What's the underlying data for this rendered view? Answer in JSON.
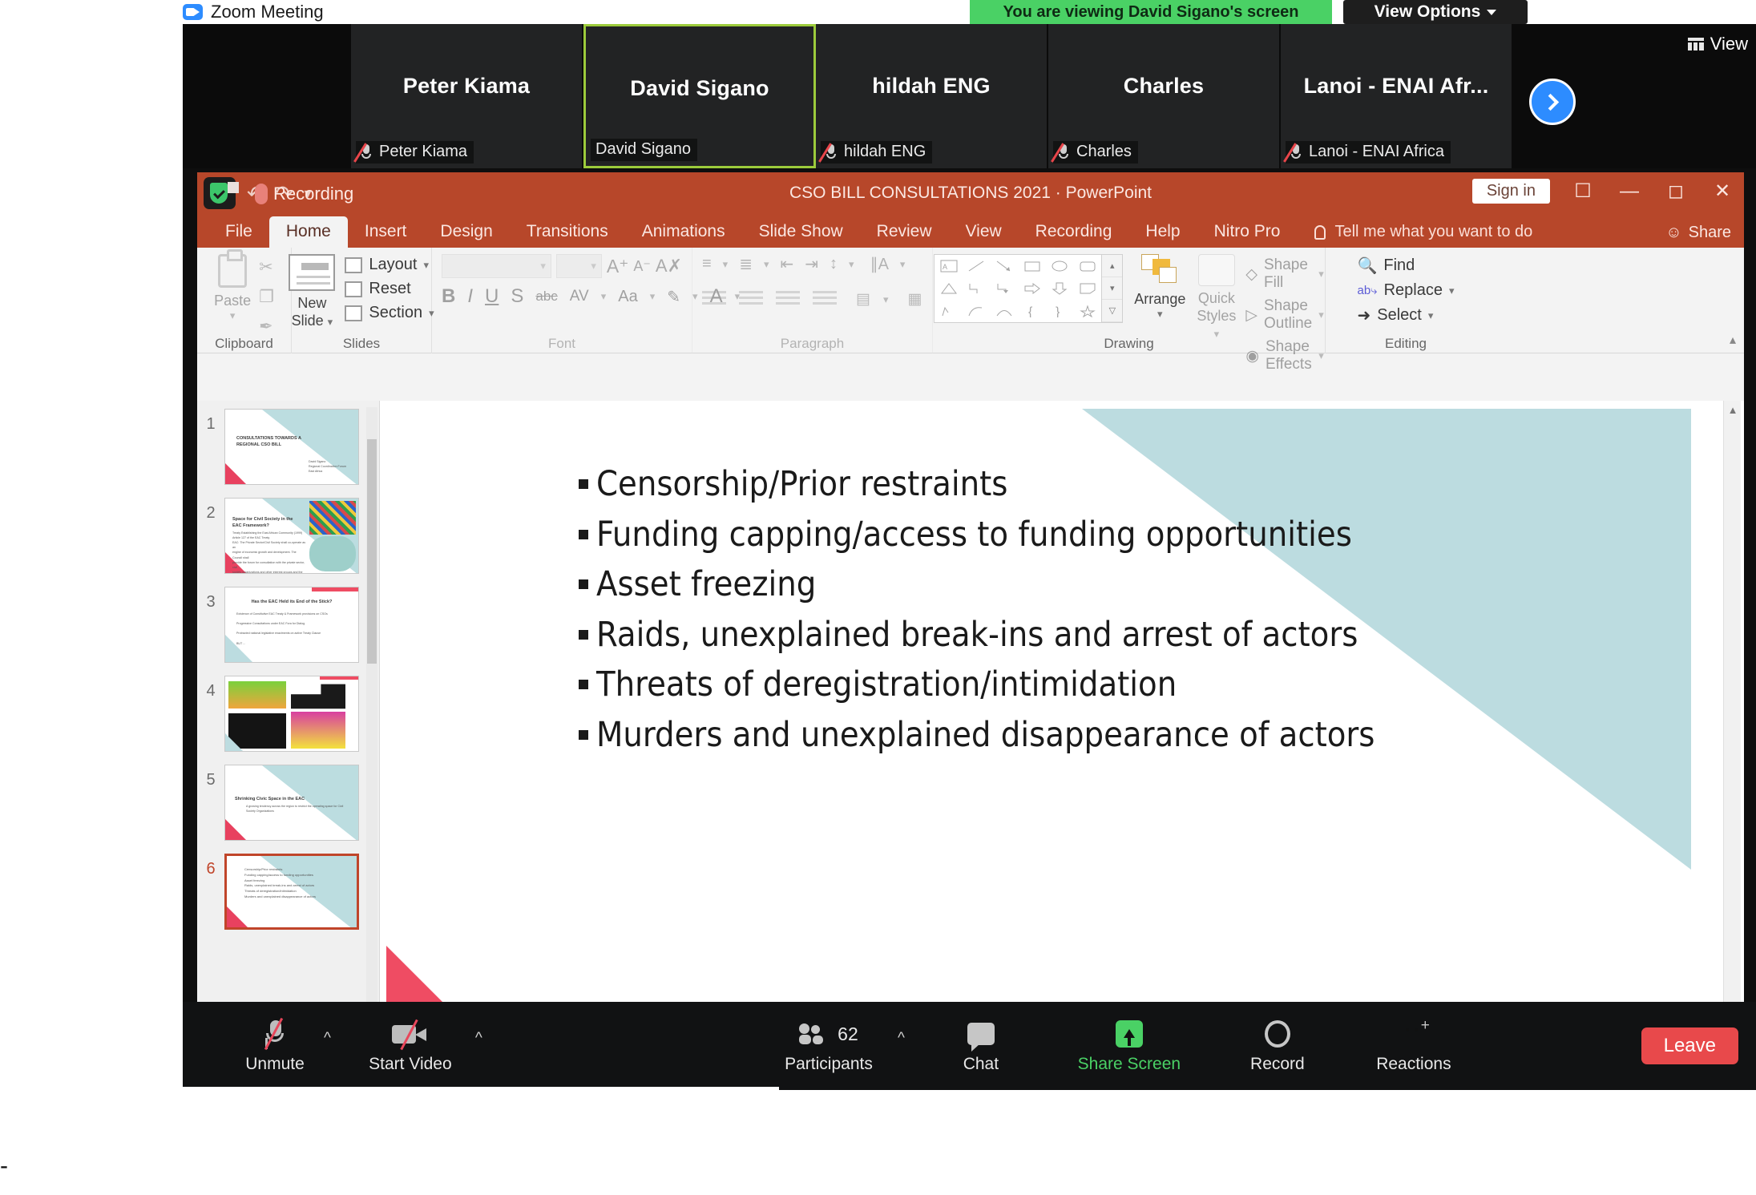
{
  "window": {
    "app_title": "Zoom Meeting",
    "zoom_logo_icon": "zoom-camera-icon"
  },
  "share_banner": {
    "text": "You are viewing David Sigano's screen",
    "view_options_label": "View Options",
    "caret_icon": "chevron-down-icon",
    "banner_color": "#4ad165"
  },
  "filmstrip": {
    "view_button_label": "View",
    "view_icon": "grid-view-icon",
    "next_icon": "chevron-right-icon",
    "participants": [
      {
        "name": "Peter Kiama",
        "footer": "Peter Kiama",
        "muted": true,
        "active": false
      },
      {
        "name": "David Sigano",
        "footer": "David Sigano",
        "muted": false,
        "active": true
      },
      {
        "name": "hildah ENG",
        "footer": "hildah ENG",
        "muted": true,
        "active": false
      },
      {
        "name": "Charles",
        "footer": "Charles",
        "muted": true,
        "active": false
      },
      {
        "name": "Lanoi - ENAI Afr...",
        "footer": "Lanoi - ENAI Africa",
        "muted": true,
        "active": false
      }
    ]
  },
  "powerpoint": {
    "document_title": "CSO BILL CONSULTATIONS 2021  ·  PowerPoint",
    "recording_label": "Recording",
    "sign_in_label": "Sign in",
    "ribbon_display_icon": "ribbon-display-options-icon",
    "minimize_icon": "minimize-icon",
    "restore_icon": "restore-icon",
    "close_icon": "close-icon",
    "share_label": "Share",
    "share_icon": "person-add-icon",
    "autosave_icon": "save-shield-icon",
    "undo_icon": "undo-icon",
    "redo_icon": "redo-icon",
    "qat_more_icon": "chevron-down-icon",
    "tabs": [
      {
        "label": "File",
        "selected": false
      },
      {
        "label": "Home",
        "selected": true
      },
      {
        "label": "Insert",
        "selected": false
      },
      {
        "label": "Design",
        "selected": false
      },
      {
        "label": "Transitions",
        "selected": false
      },
      {
        "label": "Animations",
        "selected": false
      },
      {
        "label": "Slide Show",
        "selected": false
      },
      {
        "label": "Review",
        "selected": false
      },
      {
        "label": "View",
        "selected": false
      },
      {
        "label": "Recording",
        "selected": false
      },
      {
        "label": "Help",
        "selected": false
      },
      {
        "label": "Nitro Pro",
        "selected": false
      }
    ],
    "tell_me": {
      "placeholder": "Tell me what you want to do",
      "icon": "lightbulb-icon"
    },
    "groups": {
      "clipboard": {
        "label": "Clipboard",
        "paste_label": "Paste",
        "cut_icon": "scissors-icon",
        "copy_icon": "copy-icon",
        "format_painter_icon": "format-painter-icon",
        "launcher_icon": "dialog-launcher-icon"
      },
      "slides": {
        "label": "Slides",
        "new_slide_label": "New\nSlide",
        "layout_label": "Layout",
        "reset_label": "Reset",
        "section_label": "Section"
      },
      "font": {
        "label": "Font",
        "font_name_value": "",
        "font_size_value": "",
        "grow_font_icon": "grow-font-icon",
        "shrink_font_icon": "shrink-font-icon",
        "clear_formatting_icon": "clear-formatting-icon",
        "bold": "B",
        "italic": "I",
        "underline": "U",
        "shadow": "S",
        "strikethrough": "abc",
        "spacing": "AV",
        "change_case": "Aa",
        "highlight_icon": "text-highlight-icon",
        "font_color_icon": "font-color-icon"
      },
      "paragraph": {
        "label": "Paragraph",
        "bullets_icon": "bullets-icon",
        "numbering_icon": "numbering-icon",
        "decrease_indent_icon": "decrease-indent-icon",
        "increase_indent_icon": "increase-indent-icon",
        "line_spacing_icon": "line-spacing-icon",
        "text_direction_icon": "text-direction-icon",
        "align_text_icon": "align-text-icon",
        "smartart_icon": "convert-to-smartart-icon",
        "align_left_icon": "align-left-icon",
        "align_center_icon": "align-center-icon",
        "align_right_icon": "align-right-icon",
        "justify_icon": "justify-icon",
        "columns_icon": "columns-icon"
      },
      "drawing": {
        "label": "Drawing",
        "arrange_label": "Arrange",
        "quick_styles_label": "Quick\nStyles",
        "shape_fill_label": "Shape Fill",
        "shape_outline_label": "Shape Outline",
        "shape_effects_label": "Shape Effects"
      },
      "editing": {
        "label": "Editing",
        "find_label": "Find",
        "replace_label": "Replace",
        "select_label": "Select",
        "find_icon": "magnifier-icon",
        "replace_icon": "replace-abc-icon",
        "select_icon": "cursor-select-icon"
      }
    },
    "thumbnails": [
      {
        "num": "1",
        "title": "CONSULTATIONS TOWARDS A REGIONAL CSO BILL",
        "body": "David Sigano\nRegional Coordination Forum\nEast Africa",
        "selected": false
      },
      {
        "num": "2",
        "title": "Space for Civil Society in the EAC Framework?",
        "body": "Treaty Establishing the East African Community (1999)\nArticle 127 of the EAC Treaty\nEAC: The Private Sector/Civil Society shall co-operate as an\nengine of economic growth and development. The Council shall\nprovide the forum for consultation with the private sector, civil\nsociety organizations and other interest groups and the\nEAC organs.",
        "selected": false
      },
      {
        "num": "3",
        "title": "Has the EAC Held its End of the Stick?",
        "body": "Existence of Constitutive EAC Treaty & Framework provisions on CSOs\n\nProgressive Consultations under EAC Fora for Dialog\n\nProtracted national legislative enactments on active Treaty Clause\n\nBUT ...",
        "selected": false
      },
      {
        "num": "4",
        "title": "",
        "body": "",
        "selected": false
      },
      {
        "num": "5",
        "title": "Shrinking Civic Space in the EAC",
        "body": "A growing tendency across the region to restrict the operating space for Civil Society Organizations",
        "selected": false
      },
      {
        "num": "6",
        "title": "",
        "body": "Censorship/Prior restraints\nFunding capping/access to funding opportunities\nAsset freezing\nRaids, unexplained break-ins and arrest of actors\nThreats of deregistration/intimidation\nMurders and unexplained disappearance of actors",
        "selected": true
      }
    ],
    "slide": {
      "bullets": [
        "Censorship/Prior restraints",
        "Funding capping/access to funding opportunities",
        "Asset freezing",
        "Raids, unexplained break-ins and arrest of actors",
        "Threats of deregistration/intimidation",
        "Murders and unexplained disappearance of actors"
      ],
      "accent_teal": "#bcdce0",
      "accent_red": "#ef4c63"
    },
    "scroll_up_icon": "scroll-up-icon",
    "scroll_down_icon": "scroll-down-icon",
    "resize_grip_icon": "resize-grip-icon"
  },
  "zoom_toolbar": {
    "buttons": [
      {
        "label": "Unmute",
        "icon": "microphone-muted-icon",
        "has_chevron": true,
        "count": "",
        "highlight": false
      },
      {
        "label": "Start Video",
        "icon": "camera-muted-icon",
        "has_chevron": true,
        "count": "",
        "highlight": false
      },
      {
        "label": "Participants",
        "icon": "participants-icon",
        "has_chevron": true,
        "count": "62",
        "highlight": false
      },
      {
        "label": "Chat",
        "icon": "chat-bubble-icon",
        "has_chevron": false,
        "count": "",
        "highlight": false
      },
      {
        "label": "Share Screen",
        "icon": "share-screen-icon",
        "has_chevron": false,
        "count": "",
        "highlight": true
      },
      {
        "label": "Record",
        "icon": "record-circle-icon",
        "has_chevron": false,
        "count": "",
        "highlight": false
      },
      {
        "label": "Reactions",
        "icon": "reactions-smiley-icon",
        "has_chevron": false,
        "count": "",
        "highlight": false
      }
    ],
    "leave_label": "Leave",
    "leave_color": "#e8494b",
    "accent_green": "#4ad165"
  },
  "misc": {
    "bottom_dash": "-"
  }
}
